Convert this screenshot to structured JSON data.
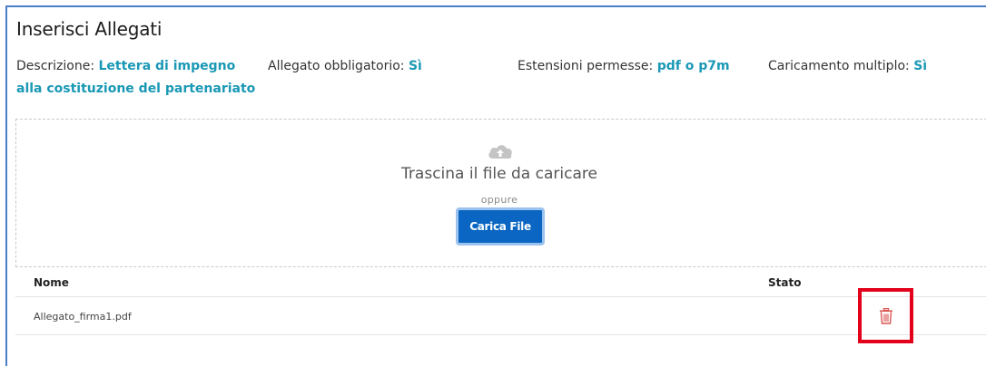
{
  "panel": {
    "title": "Inserisci Allegati",
    "description_label": "Descrizione: ",
    "description_value": "Lettera di impegno alla costituzione del partenariato",
    "obbligatorio_label": "Allegato obbligatorio: ",
    "obbligatorio_value": "Sì",
    "estensioni_label": "Estensioni permesse: ",
    "estensioni_value": "pdf o p7m",
    "multiplo_label": "Caricamento multiplo: ",
    "multiplo_value": "Sì"
  },
  "dropzone": {
    "icon": "cloud-upload-icon",
    "text": "Trascina il file da caricare",
    "or_text": "oppure",
    "button_label": "Carica File"
  },
  "table": {
    "columns": [
      "Nome",
      "Stato"
    ],
    "rows": [
      {
        "nome": "Allegato_firma1.pdf",
        "action_icon": "trash-icon"
      }
    ]
  },
  "colors": {
    "accent_value": "#1a98b5",
    "button": "#0a66c2",
    "highlight": "#e3001b",
    "trash": "#d9534f"
  }
}
